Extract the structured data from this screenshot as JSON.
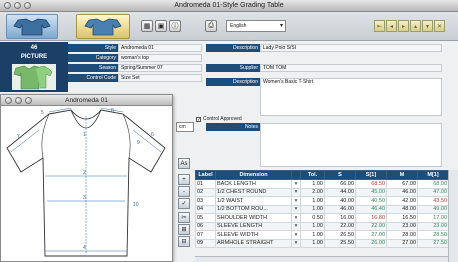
{
  "window": {
    "title": "Andromeda 01-Style Grading Table"
  },
  "toolbar": {
    "lang_value": "English",
    "icons": [
      "garment-icon",
      "tshirt-icon",
      "grid-icon",
      "image-icon",
      "info-icon",
      "print-icon"
    ],
    "nav": [
      "⇤",
      "◂",
      "▸",
      "▴",
      "▾",
      "✕"
    ]
  },
  "left_panel": {
    "number": "46",
    "picture_label": "PICTURE"
  },
  "form": {
    "labels": {
      "style": "Style",
      "category": "Category",
      "season": "Season",
      "control_code": "Control Code",
      "description": "Description",
      "supplier": "Supplier",
      "description2": "Description",
      "control_approved": "Control Approved",
      "notes": "Notes"
    },
    "values": {
      "style": "Andromeda 01",
      "category": "woman's top",
      "season": "Spring/Summer 07",
      "control_code": "Size Set",
      "description": "Lady Polo S/SI",
      "supplier": "TOM TOM",
      "description2": "Women's Basic T-Shirt"
    }
  },
  "float_window": {
    "title": "Andromeda 01",
    "markers": [
      "1",
      "2",
      "3",
      "4",
      "5",
      "6",
      "7",
      "8",
      "9",
      "10"
    ]
  },
  "mid": {
    "units_value": "cm",
    "side_tools": [
      "As",
      "+",
      "-",
      "✓",
      "✂",
      "⊞",
      "⊟"
    ]
  },
  "table": {
    "headers": [
      "Label",
      "Dimension",
      "",
      "Tol.",
      "S",
      "S[1]",
      "M",
      "M[1]"
    ],
    "rows": [
      {
        "label": "01",
        "dim": "BACK LENGTH",
        "tol": "1.00",
        "s": "66.00",
        "s1": "68.50",
        "m": "67.00",
        "m1": "68.00",
        "s1c": "red",
        "m1c": "green"
      },
      {
        "label": "02",
        "dim": "1/2 CHEST ROUND",
        "tol": "2.00",
        "s": "44.00",
        "s1": "45.00",
        "m": "46.00",
        "m1": "47.00",
        "s1c": "green",
        "m1c": "green"
      },
      {
        "label": "03",
        "dim": "1/2 WAIST",
        "tol": "1.00",
        "s": "40.00",
        "s1": "40.50",
        "m": "42.00",
        "m1": "43.50",
        "s1c": "green",
        "m1c": "red"
      },
      {
        "label": "04",
        "dim": "1/2 BOTTOM ROU...",
        "tol": "1.00",
        "s": "46.00",
        "s1": "46.40",
        "m": "48.00",
        "m1": "49.00",
        "s1c": "green",
        "m1c": "green"
      },
      {
        "label": "05",
        "dim": "SHOULDER WIDTH",
        "tol": "0.50",
        "s": "16.00",
        "s1": "16.80",
        "m": "16.50",
        "m1": "17.00",
        "s1c": "red",
        "m1c": "green"
      },
      {
        "label": "06",
        "dim": "SLEEVE LENGTH",
        "tol": "1.00",
        "s": "22.00",
        "s1": "22.00",
        "m": "23.00",
        "m1": "23.00",
        "s1c": "green",
        "m1c": "green"
      },
      {
        "label": "07",
        "dim": "SLEEVE WIDTH",
        "tol": "1.00",
        "s": "26.50",
        "s1": "27.00",
        "m": "28.00",
        "m1": "28.50",
        "s1c": "green",
        "m1c": "green"
      },
      {
        "label": "09",
        "dim": "ARMHOLE STRAIGHT",
        "tol": "1.00",
        "s": "25.50",
        "s1": "26.00",
        "m": "27.00",
        "m1": "27.50",
        "s1c": "green",
        "m1c": "green"
      }
    ]
  }
}
